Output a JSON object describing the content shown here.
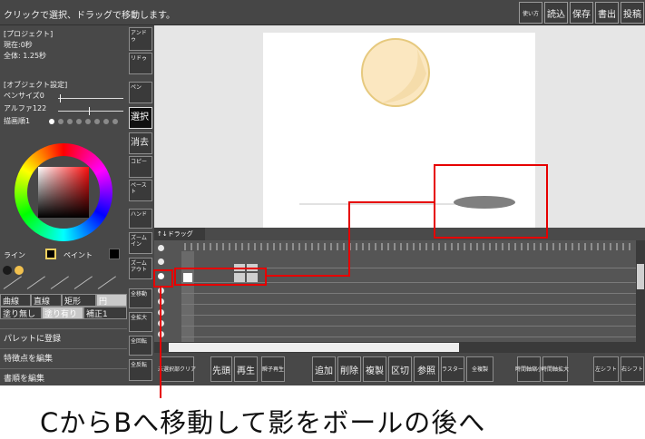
{
  "status_text": "クリックで選択、ドラッグで移動します。",
  "top_buttons": [
    "使い方",
    "読込",
    "保存",
    "書出",
    "投稿"
  ],
  "project": {
    "header": "[プロジェクト]",
    "current": "現在:0秒",
    "total": "全体: 1.25秒"
  },
  "object_settings": {
    "header": "[オブジェクト設定]",
    "pen_size": "ペンサイズ0",
    "alpha": "アルファ122",
    "draw_order": "描画順1"
  },
  "color": {
    "line_label": "ライン",
    "paint_label": "ペイント",
    "line_color": "#f0d060",
    "paint_color": "#000000",
    "palette_colors": [
      "#1a1a1a",
      "#f2c14e"
    ]
  },
  "shape_buttons": [
    "曲線",
    "直線",
    "矩形",
    "円"
  ],
  "fill_buttons": [
    "塗り無し",
    "塗り有り",
    "補正1"
  ],
  "left_menu": [
    "パレットに登録",
    "特徴点を編集",
    "書順を編集"
  ],
  "tools": [
    "アンドゥ",
    "リドゥ",
    "ペン",
    "選択",
    "消去",
    "コピー",
    "ペースト",
    "ハンド",
    "ズームイン",
    "ズームアウト",
    "全移動",
    "全拡大",
    "全回転",
    "全反転"
  ],
  "timeline_tab": "↑↓ドラッグ",
  "bottom_buttons": [
    "未選択部クリア",
    "先頭",
    "再生",
    "瞬子再生",
    "追加",
    "削除",
    "複製",
    "区切",
    "参照",
    "ラスター",
    "全複製",
    "時間軸縮小",
    "時間軸拡大",
    "左シフト",
    "右シフト"
  ],
  "caption": "CからBへ移動して影をボールの後へ"
}
